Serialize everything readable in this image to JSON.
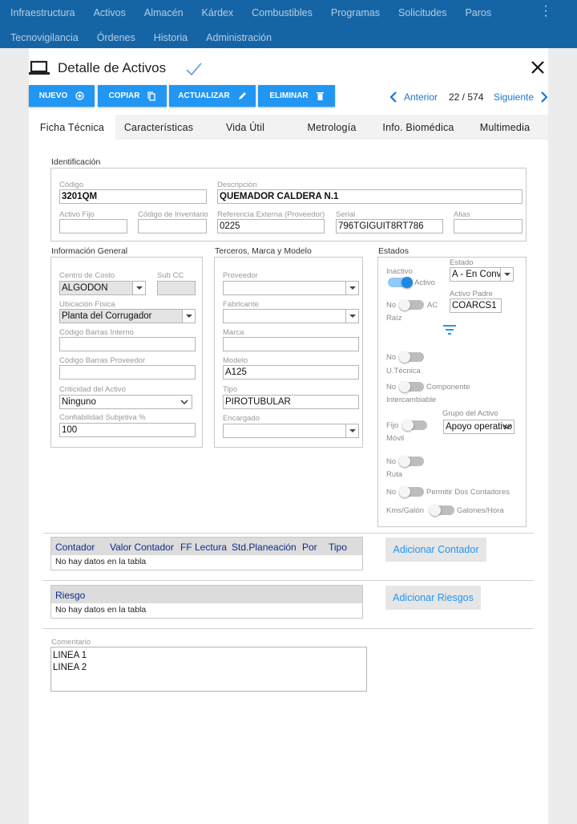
{
  "nav": {
    "row1": [
      "Infraestructura",
      "Activos",
      "Almacén",
      "Kárdex",
      "Combustibles",
      "Programas",
      "Solicitudes",
      "Paros"
    ],
    "row2": [
      "Tecnovigilancia",
      "Órdenes",
      "Historia",
      "Administración"
    ]
  },
  "header": {
    "title": "Detalle de Activos"
  },
  "toolbar": {
    "nuevo": "NUEVO",
    "copiar": "COPIAR",
    "actualizar": "ACTUALIZAR",
    "eliminar": "ELIMINAR"
  },
  "pager": {
    "prev": "Anterior",
    "position": "22 / 574",
    "next": "Siguiente"
  },
  "tabs": [
    "Ficha Técnica",
    "Características",
    "Vida Útil",
    "Metrología",
    "Info. Biomédica",
    "Multimedia"
  ],
  "identificacion": {
    "section": "Identificación",
    "codigo_label": "Código",
    "codigo": "3201QM",
    "descripcion_label": "Descripción",
    "descripcion": "QUEMADOR CALDERA N.1",
    "activo_fijo_label": "Activo Fijo",
    "activo_fijo": "",
    "codigo_inventario_label": "Código de Inventario",
    "codigo_inventario": "",
    "referencia_label": "Referencia Externa (Proveedor)",
    "referencia": "0225",
    "serial_label": "Serial",
    "serial": "796TGIGUIT8RT786",
    "alias_label": "Alias",
    "alias": ""
  },
  "info_general": {
    "section": "Información General",
    "centro_costo_label": "Centro de Costo",
    "centro_costo": "ALGODON",
    "sub_cc_label": "Sub CC",
    "sub_cc": "",
    "ubicacion_label": "Ubicación Física",
    "ubicacion": "Planta del Corrugador",
    "cb_interno_label": "Código Barras Interno",
    "cb_interno": "",
    "cb_proveedor_label": "Código Barras Proveedor",
    "cb_proveedor": "",
    "criticidad_label": "Criticidad del Activo",
    "criticidad": "Ninguno",
    "confiabilidad_label": "Confiabilidad Subjetiva %",
    "confiabilidad": "100"
  },
  "terceros": {
    "section": "Terceros, Marca y Modelo",
    "proveedor_label": "Proveedor",
    "proveedor": "",
    "fabricante_label": "Fabricante",
    "fabricante": "",
    "marca_label": "Marca",
    "marca": "",
    "modelo_label": "Modelo",
    "modelo": "A125",
    "tipo_label": "Tipo",
    "tipo": "PIROTUBULAR",
    "encargado_label": "Encargado",
    "encargado": ""
  },
  "estados": {
    "section": "Estados",
    "inactivo": "Inactivo",
    "activo": "Activo",
    "estado_label": "Estado",
    "estado": "A - En Convenio",
    "activo_padre_label": "Activo Padre",
    "activo_padre": "COARCS1",
    "no": "No",
    "ac": "AC",
    "raiz": "Raíz",
    "utecnica": "U.Técnica",
    "componente": "Componente",
    "intercambiable": "Intercambiable",
    "fijo": "Fijo",
    "movil": "Móvil",
    "grupo_label": "Grupo del Activo",
    "grupo": "Apoyo operativo",
    "ruta": "Ruta",
    "permitir": "Permitir Dos Contadores",
    "kms": "Kms/Galón",
    "galones": "Galones/Hora"
  },
  "contadores": {
    "headers": [
      "Contador",
      "Valor Contador",
      "FF Lectura",
      "Std.Planeación",
      "Por",
      "Tipo"
    ],
    "empty": "No hay datos en la tabla",
    "add": "Adicionar Contador"
  },
  "riesgos": {
    "header": "Riesgo",
    "empty": "No hay datos en la tabla",
    "add": "Adicionar Riesgos"
  },
  "comentario": {
    "label": "Comentario",
    "line1": "LINEA 1",
    "line2": "LINEA 2"
  },
  "colors": {
    "nav": "#1565a6",
    "accent": "#2196f3",
    "link": "#1976d2",
    "header_text": "#0d2a8a"
  }
}
